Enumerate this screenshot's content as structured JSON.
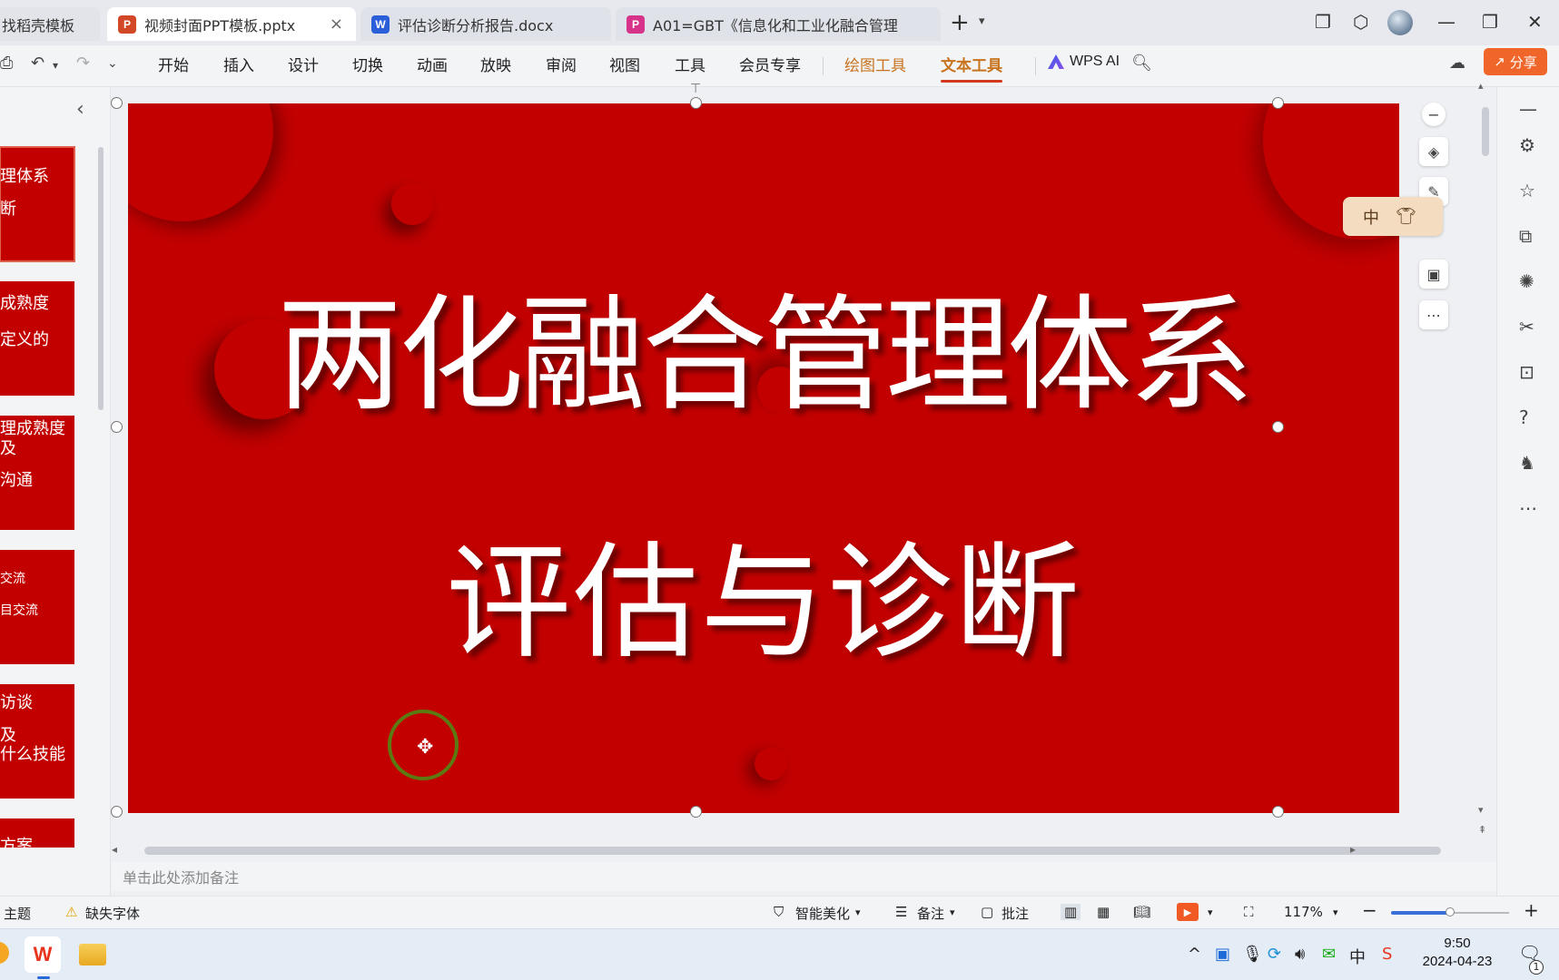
{
  "tabs": [
    {
      "label": "找稻壳模板",
      "icon": "",
      "icon_color": ""
    },
    {
      "label": "视频封面PPT模板.pptx",
      "icon": "P",
      "icon_color": "#d24726"
    },
    {
      "label": "评估诊断分析报告.docx",
      "icon": "W",
      "icon_color": "#2b5fd9"
    },
    {
      "label": "A01=GBT《信息化和工业化融合管理",
      "icon": "P",
      "icon_color": "#d7338a"
    }
  ],
  "tab_close": "×",
  "menu": {
    "items": [
      "开始",
      "插入",
      "设计",
      "切换",
      "动画",
      "放映",
      "审阅",
      "视图",
      "工具",
      "会员专享"
    ],
    "draw_tools": "绘图工具",
    "text_tools": "文本工具",
    "ai": "WPS AI",
    "share": "分享"
  },
  "thumbnails": [
    {
      "lines": [
        "理体系",
        "断"
      ]
    },
    {
      "lines": [
        "成熟度",
        "定义的"
      ]
    },
    {
      "lines": [
        "理成熟度",
        "及",
        "沟通"
      ]
    },
    {
      "lines": [
        "交流",
        "目交流"
      ]
    },
    {
      "lines": [
        "访谈",
        "",
        "及",
        "什么技能"
      ]
    },
    {
      "lines": [
        "方案"
      ]
    }
  ],
  "slide": {
    "title_line1": "两化融合管理体系",
    "title_line2": "评估与诊断",
    "background": "#c20000"
  },
  "ime": {
    "label": "中",
    "icon": "shirt-icon"
  },
  "notes_placeholder": "单击此处添加备注",
  "status": {
    "theme": "主题",
    "missing_font": "缺失字体",
    "beautify": "智能美化",
    "notes": "备注",
    "comments": "批注",
    "zoom": "117%",
    "zoom_level": 0.5
  },
  "clock": {
    "time": "9:50",
    "date": "2024-04-23"
  },
  "notif_count": "1",
  "colors": {
    "accent": "#f0652a",
    "text_tools": "#c8741f",
    "slide_red": "#c20000"
  }
}
